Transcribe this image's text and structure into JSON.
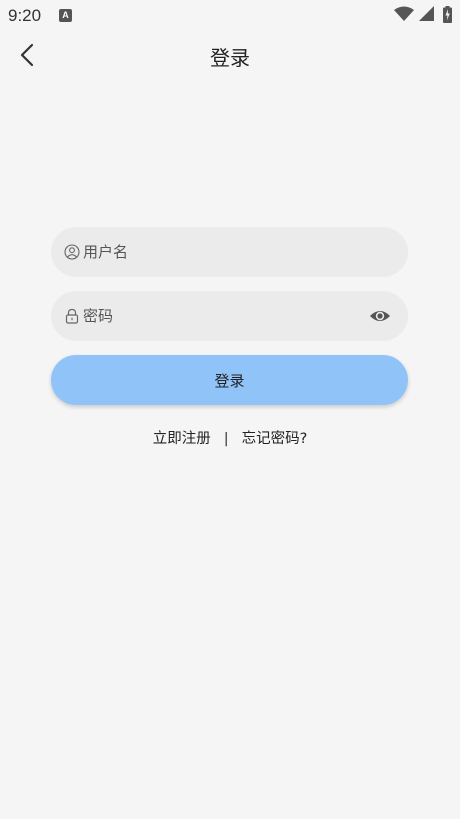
{
  "status_bar": {
    "time": "9:20",
    "notification_icon": "a-letter-icon",
    "icons": [
      "wifi-icon",
      "cellular-signal-icon",
      "battery-charging-icon"
    ]
  },
  "header": {
    "back_icon": "chevron-left-icon",
    "title": "登录"
  },
  "form": {
    "username": {
      "icon": "user-icon",
      "placeholder": "用户名",
      "value": ""
    },
    "password": {
      "icon": "lock-icon",
      "placeholder": "密码",
      "value": "",
      "toggle_icon": "eye-icon"
    },
    "submit_label": "登录"
  },
  "links": {
    "register": "立即注册",
    "divider": "|",
    "forgot": "忘记密码?"
  },
  "colors": {
    "background": "#f5f5f5",
    "field_background": "#ebebeb",
    "button": "#90c4f8"
  }
}
